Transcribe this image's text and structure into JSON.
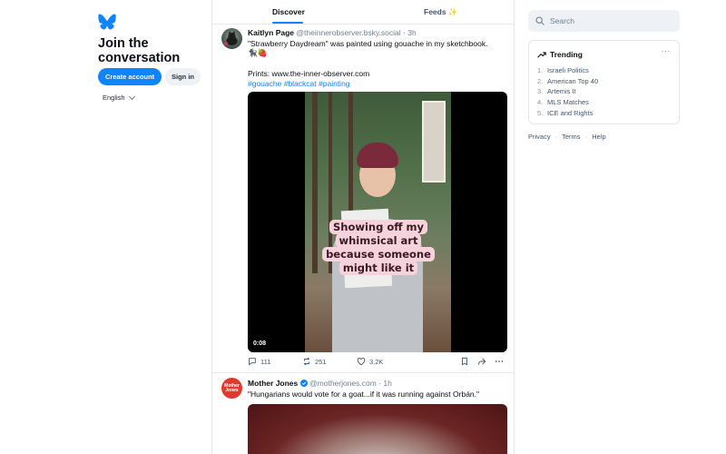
{
  "left": {
    "heading": "Join the conversation",
    "create_account": "Create account",
    "sign_in": "Sign in",
    "language": "English"
  },
  "tabs": {
    "discover": "Discover",
    "feeds": "Feeds ✨"
  },
  "post1": {
    "author": "Kaitlyn Page",
    "handle": "@theinnerobserver.bsky.social",
    "time": "· 3h",
    "line1": "\"Strawberry Daydream\" was painted using gouache in my sketchbook.",
    "emoji": "🐈‍⬛🍓",
    "prints": "Prints: www.the-inner-observer.com",
    "tag1": "#gouache",
    "tag2": "#blackcat",
    "tag3": "#painting",
    "video_caption": "Showing off my whimsical art because someone might like it",
    "video_time": "0:08",
    "replies": "111",
    "reposts": "251",
    "likes": "3.2K"
  },
  "post2": {
    "author": "Mother Jones",
    "handle": "@motherjones.com",
    "time": "· 1h",
    "text": "\"Hungarians would vote for a goat...if it was running against Orbán.\"",
    "avatar_text": "Mother Jones"
  },
  "search": {
    "placeholder": "Search"
  },
  "trending": {
    "title": "Trending",
    "more": "···",
    "items": [
      {
        "num": "1.",
        "label": "Israeli Politics"
      },
      {
        "num": "2.",
        "label": "American Top 40"
      },
      {
        "num": "3.",
        "label": "Artemis II"
      },
      {
        "num": "4.",
        "label": "MLS Matches"
      },
      {
        "num": "5.",
        "label": "ICE and Rights"
      }
    ]
  },
  "footer": {
    "privacy": "Privacy",
    "terms": "Terms",
    "help": "Help",
    "sep": "·"
  },
  "colors": {
    "accent": "#1083fe",
    "text": "#0b0f14",
    "muted": "#6f7f92"
  }
}
